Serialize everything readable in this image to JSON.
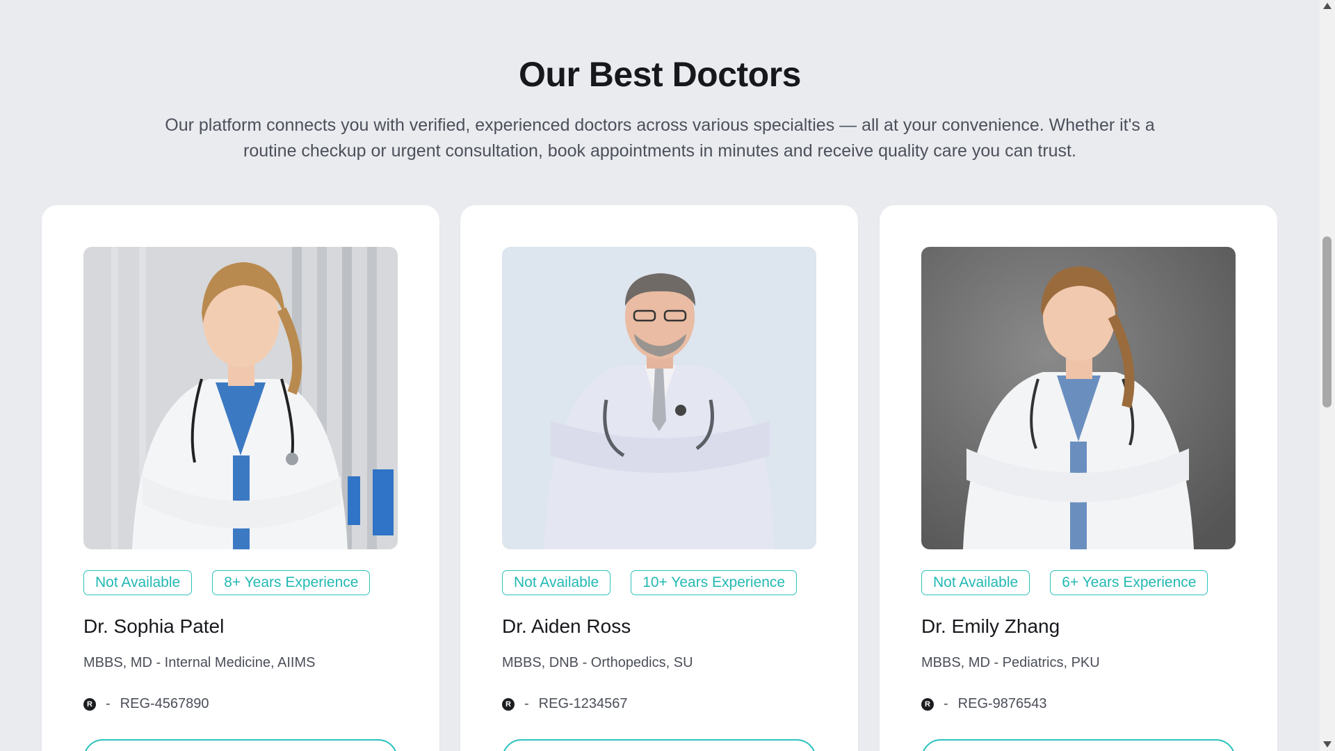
{
  "section": {
    "title": "Our Best Doctors",
    "description": "Our platform connects you with verified, experienced doctors across various specialties — all at your convenience. Whether it's a routine checkup or urgent consultation, book appointments in minutes and receive quality care you can trust."
  },
  "doctors": [
    {
      "availability": "Not Available",
      "experience": "8+ Years Experience",
      "name": "Dr. Sophia Patel",
      "qualification": "MBBS, MD - Internal Medicine, AIIMS",
      "reg_icon": "R",
      "reg_separator": "-",
      "reg": "REG-4567890",
      "photo_background": "#d8dadd"
    },
    {
      "availability": "Not Available",
      "experience": "10+ Years Experience",
      "name": "Dr. Aiden Ross",
      "qualification": "MBBS, DNB - Orthopedics, SU",
      "reg_icon": "R",
      "reg_separator": "-",
      "reg": "REG-1234567",
      "photo_background": "#dde6ef"
    },
    {
      "availability": "Not Available",
      "experience": "6+ Years Experience",
      "name": "Dr. Emily Zhang",
      "qualification": "MBBS, MD - Pediatrics, PKU",
      "reg_icon": "R",
      "reg_separator": "-",
      "reg": "REG-9876543",
      "photo_background": "#6f6f6f"
    }
  ],
  "colors": {
    "accent": "#22b8b3",
    "page_background": "#e9ebef",
    "card_background": "#ffffff"
  }
}
